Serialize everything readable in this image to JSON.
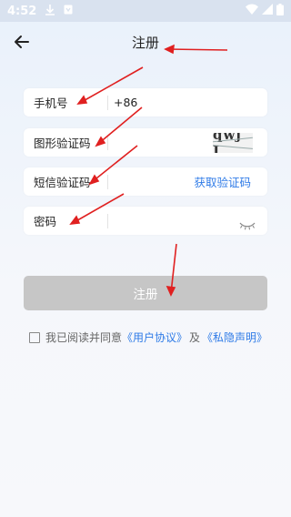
{
  "status_bar": {
    "time": "4:52",
    "icons": [
      "download-icon",
      "store-icon",
      "wifi-icon",
      "signal-icon",
      "battery-icon"
    ]
  },
  "header": {
    "title": "注册",
    "back_icon": "arrow-left-icon"
  },
  "form": {
    "phone": {
      "label": "手机号",
      "country_code": "+86"
    },
    "captcha": {
      "label": "图形验证码",
      "image_text": "qwj J"
    },
    "sms": {
      "label": "短信验证码",
      "action": "获取验证码"
    },
    "password": {
      "label": "密码",
      "icon": "eye-closed-icon"
    }
  },
  "submit": {
    "label": "注册"
  },
  "agreement": {
    "prefix": "我已阅读并同意",
    "user_agreement": "《用户协议》",
    "conjunction": "及",
    "privacy": "《私隐声明》"
  },
  "colors": {
    "accent": "#2f7be7",
    "button_disabled": "#c6c6c6",
    "annotation": "#e02020"
  }
}
